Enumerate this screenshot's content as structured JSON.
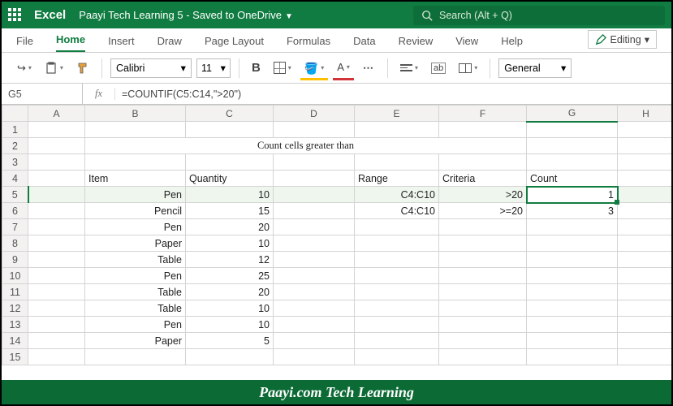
{
  "titlebar": {
    "app": "Excel",
    "doc": "Paayi Tech Learning 5 - Saved to OneDrive",
    "search_placeholder": "Search (Alt + Q)"
  },
  "tabs": {
    "file": "File",
    "home": "Home",
    "insert": "Insert",
    "draw": "Draw",
    "page_layout": "Page Layout",
    "formulas": "Formulas",
    "data": "Data",
    "review": "Review",
    "view": "View",
    "help": "Help",
    "editing": "Editing"
  },
  "toolbar": {
    "font": "Calibri",
    "size": "11",
    "num_format": "General",
    "bold": "B",
    "font_color_letter": "A"
  },
  "formula_bar": {
    "cell": "G5",
    "fx": "fx",
    "formula": "=COUNTIF(C5:C14,\">20\")"
  },
  "columns": [
    "A",
    "B",
    "C",
    "D",
    "E",
    "F",
    "G",
    "H"
  ],
  "sheet_title": "Count cells greater than",
  "headers": {
    "item": "Item",
    "quantity": "Quantity",
    "range": "Range",
    "criteria": "Criteria",
    "count": "Count"
  },
  "rows": [
    {
      "n": "5",
      "item": "Pen",
      "qty": "10",
      "range": "C4:C10",
      "criteria": ">20",
      "count": "1"
    },
    {
      "n": "6",
      "item": "Pencil",
      "qty": "15",
      "range": "C4:C10",
      "criteria": ">=20",
      "count": "3"
    },
    {
      "n": "7",
      "item": "Pen",
      "qty": "20"
    },
    {
      "n": "8",
      "item": "Paper",
      "qty": "10"
    },
    {
      "n": "9",
      "item": "Table",
      "qty": "12"
    },
    {
      "n": "10",
      "item": "Pen",
      "qty": "25"
    },
    {
      "n": "11",
      "item": "Table",
      "qty": "20"
    },
    {
      "n": "12",
      "item": "Table",
      "qty": "10"
    },
    {
      "n": "13",
      "item": "Pen",
      "qty": "10"
    },
    {
      "n": "14",
      "item": "Paper",
      "qty": "5"
    }
  ],
  "footer": "Paayi.com Tech Learning",
  "chart_data": {
    "type": "table",
    "title": "Count cells greater than",
    "columns": [
      "Item",
      "Quantity"
    ],
    "data": [
      [
        "Pen",
        10
      ],
      [
        "Pencil",
        15
      ],
      [
        "Pen",
        20
      ],
      [
        "Paper",
        10
      ],
      [
        "Table",
        12
      ],
      [
        "Pen",
        25
      ],
      [
        "Table",
        20
      ],
      [
        "Table",
        10
      ],
      [
        "Pen",
        10
      ],
      [
        "Paper",
        5
      ]
    ],
    "countif": [
      {
        "range": "C4:C10",
        "criteria": ">20",
        "count": 1
      },
      {
        "range": "C4:C10",
        "criteria": ">=20",
        "count": 3
      }
    ]
  }
}
